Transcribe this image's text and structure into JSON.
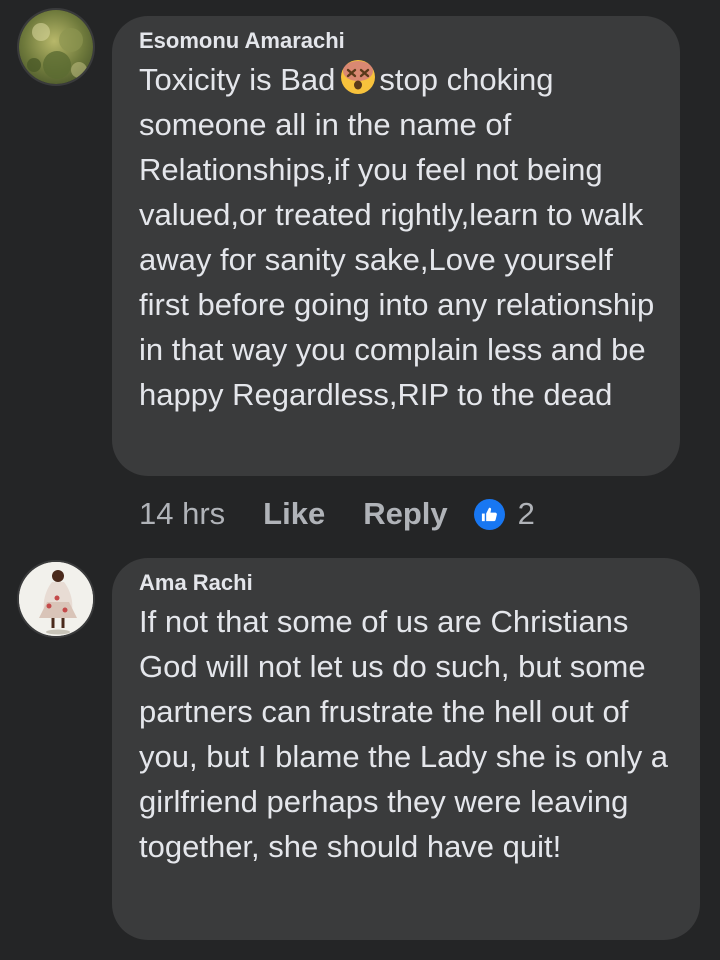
{
  "comments": [
    {
      "author": "Esomonu Amarachi",
      "text_before_emoji": "Toxicity is Bad",
      "emoji": "dizzy-face-emoji",
      "text_after_emoji": "stop choking someone all in the name of Relationships,if you feel not being valued,or treated rightly,learn to walk away for sanity sake,Love yourself first before going into any relationship in that way you complain less and be happy Regardless,RIP to the dead",
      "time": "14 hrs",
      "like_label": "Like",
      "reply_label": "Reply",
      "reaction_icon": "thumbs-up-icon",
      "reaction_count": "2"
    },
    {
      "author": "Ama Rachi",
      "text": "If not that some of us are Christians God will not let us do such, but some partners can frustrate the hell out of you, but I blame the Lady she is only a girlfriend perhaps they were leaving together, she should have quit!"
    }
  ],
  "colors": {
    "background": "#242526",
    "bubble": "#3a3b3c",
    "text_primary": "#e4e6eb",
    "text_secondary": "#b0b3b8",
    "reaction_blue": "#1877f2"
  }
}
